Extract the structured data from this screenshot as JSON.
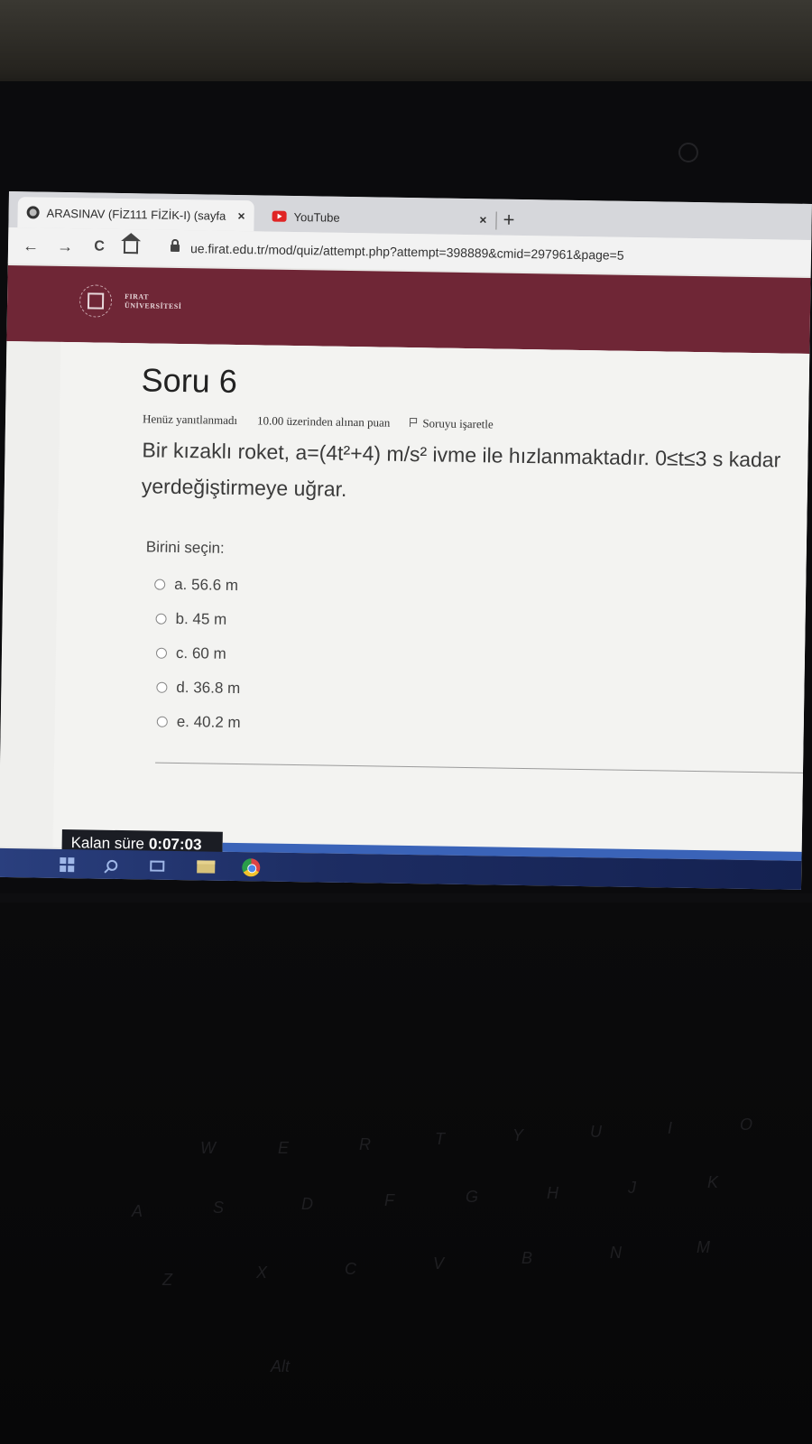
{
  "browser": {
    "tabs": [
      {
        "title": "ARASINAV (FİZ111 FİZİK-I) (sayfa",
        "close": "×",
        "active": true
      },
      {
        "title": "YouTube",
        "close": "×",
        "active": false
      }
    ],
    "new_tab": "+",
    "nav": {
      "back": "←",
      "forward": "→",
      "reload": "C"
    },
    "url": "ue.firat.edu.tr/mod/quiz/attempt.php?attempt=398889&cmid=297961&page=5"
  },
  "site": {
    "logo_line1": "FIRAT",
    "logo_line2": "ÜNİVERSİTESİ"
  },
  "question": {
    "title": "Soru 6",
    "status": "Henüz yanıtlanmadı",
    "points": "10.00 üzerinden alınan puan",
    "flag": "Soruyu işaretle",
    "text": "Bir kızaklı roket, a=(4t²+4) m/s² ivme ile hızlanmaktadır. 0≤t≤3 s kadar yerdeğiştirmeye uğrar.",
    "prompt": "Birini seçin:",
    "options": [
      {
        "label": "a. 56.6 m"
      },
      {
        "label": "b. 45 m"
      },
      {
        "label": "c. 60 m"
      },
      {
        "label": "d. 36.8 m"
      },
      {
        "label": "e. 40.2 m"
      }
    ]
  },
  "timer": {
    "label": "Kalan süre",
    "value": "0:07:03"
  },
  "colors": {
    "header": "#6f2636",
    "taskbar": "#1d2d63",
    "timer_bg": "#1b1d24"
  },
  "keyboard": {
    "keys": [
      "W",
      "E",
      "R",
      "T",
      "Y",
      "U",
      "I",
      "O",
      "A",
      "S",
      "D",
      "F",
      "G",
      "H",
      "J",
      "K",
      "Z",
      "X",
      "C",
      "V",
      "B",
      "N",
      "M",
      "Alt"
    ]
  }
}
